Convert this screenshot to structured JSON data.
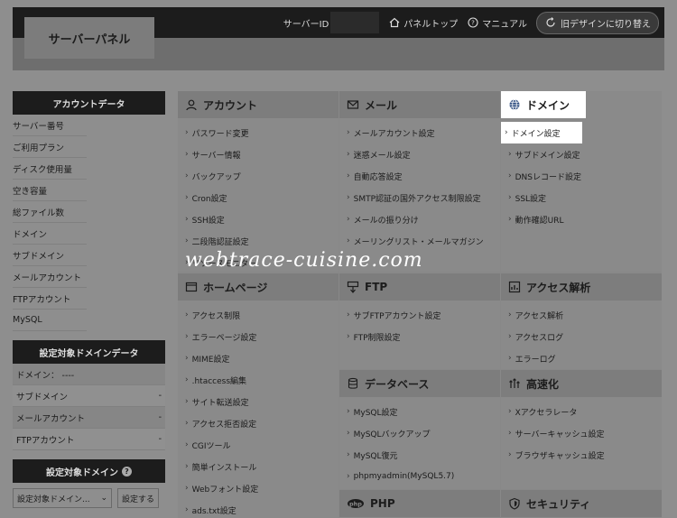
{
  "topbar": {
    "server_id_label": "サーバーID",
    "panel_top": "パネルトップ",
    "manual": "マニュアル",
    "old_design": "旧デザインに切り替え"
  },
  "panel_title": "サーバーパネル",
  "sidebar": {
    "account_data_title": "アカウントデータ",
    "account_items": [
      "サーバー番号",
      "ご利用プラン",
      "ディスク使用量",
      "空き容量",
      "総ファイル数",
      "ドメイン",
      "サブドメイン",
      "メールアカウント",
      "FTPアカウント",
      "MySQL"
    ],
    "target_domain_data_title": "設定対象ドメインデータ",
    "target_items": [
      {
        "label": "ドメイン： ----",
        "value": ""
      },
      {
        "label": "サブドメイン",
        "value": "-"
      },
      {
        "label": "メールアカウント",
        "value": "-"
      },
      {
        "label": "FTPアカウント",
        "value": "-"
      }
    ],
    "target_domain_title": "設定対象ドメイン",
    "select_placeholder": "設定対象ドメイン...",
    "set_button": "設定する"
  },
  "sections": {
    "account": {
      "title": "アカウント",
      "items": [
        "パスワード変更",
        "サーバー情報",
        "バックアップ",
        "Cron設定",
        "SSH設定",
        "二段階認証設定",
        "リソースモニター"
      ]
    },
    "mail": {
      "title": "メール",
      "items": [
        "メールアカウント設定",
        "迷惑メール設定",
        "自動応答設定",
        "SMTP認証の国外アクセス制限設定",
        "メールの振り分け",
        "メーリングリスト・メールマガジン"
      ]
    },
    "domain": {
      "title": "ドメイン",
      "items": [
        "ドメイン設定",
        "サブドメイン設定",
        "DNSレコード設定",
        "SSL設定",
        "動作確認URL"
      ]
    },
    "homepage": {
      "title": "ホームページ",
      "items": [
        "アクセス制限",
        "エラーページ設定",
        "MIME設定",
        ".htaccess編集",
        "サイト転送設定",
        "アクセス拒否設定",
        "CGIツール",
        "簡単インストール",
        "Webフォント設定",
        "ads.txt設定"
      ]
    },
    "ftp": {
      "title": "FTP",
      "items": [
        "サブFTPアカウント設定",
        "FTP制限設定"
      ]
    },
    "access": {
      "title": "アクセス解析",
      "items": [
        "アクセス解析",
        "アクセスログ",
        "エラーログ"
      ]
    },
    "database": {
      "title": "データベース",
      "items": [
        "MySQL設定",
        "MySQLバックアップ",
        "MySQL復元",
        "phpmyadmin(MySQL5.7)"
      ]
    },
    "speed": {
      "title": "高速化",
      "items": [
        "Xアクセラレータ",
        "サーバーキャッシュ設定",
        "ブラウザキャッシュ設定"
      ]
    },
    "php": {
      "title": "PHP"
    },
    "security": {
      "title": "セキュリティ"
    }
  },
  "watermark": "webtrace-cuisine.com"
}
